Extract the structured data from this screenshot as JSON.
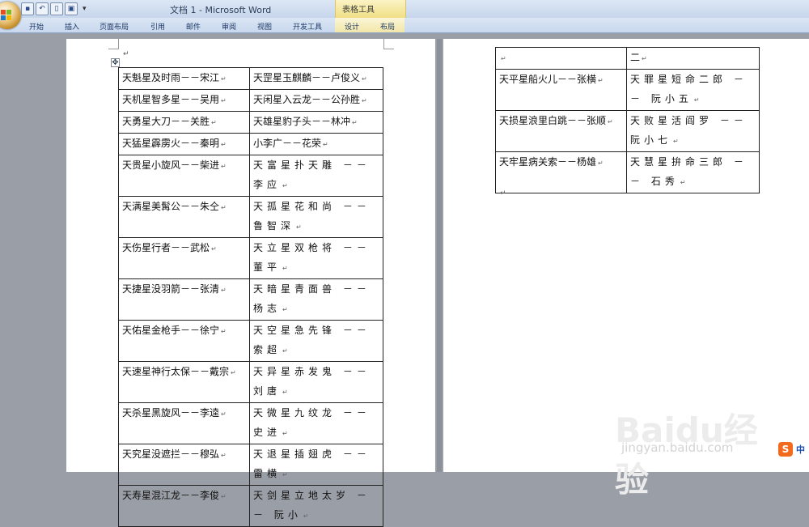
{
  "window": {
    "title": "文档 1 - Microsoft Word",
    "contextual_group": "表格工具",
    "qat_more": "▾"
  },
  "ribbon": {
    "tabs": [
      "开始",
      "插入",
      "页面布局",
      "引用",
      "邮件",
      "审阅",
      "视图",
      "开发工具",
      "设计",
      "布局"
    ]
  },
  "page1": {
    "rows": [
      [
        "天魁星及时雨－－宋江",
        "天罡星玉麒麟－－卢俊义"
      ],
      [
        "天机星智多星－－吴用",
        "天闲星入云龙－－公孙胜"
      ],
      [
        "天勇星大刀－－关胜",
        "天雄星豹子头－－林冲"
      ],
      [
        "天猛星霹雳火－－秦明",
        "小李广－－花荣"
      ],
      [
        "天贵星小旋风－－柴进",
        "天富星扑天雕 －－ 李应"
      ],
      [
        "天满星美髯公－－朱仝",
        "天孤星花和尚 －－ 鲁智深"
      ],
      [
        "天伤星行者－－武松",
        "天立星双枪将 －－ 董平"
      ],
      [
        "天捷星没羽箭－－张清",
        "天暗星青面兽 －－ 杨志"
      ],
      [
        "天佑星金枪手－－徐宁",
        "天空星急先锋 －－ 索超"
      ],
      [
        "天速星神行太保－－戴宗",
        "天异星赤发鬼 －－ 刘唐"
      ],
      [
        "天杀星黑旋风－－李逵",
        "天微星九纹龙 －－ 史进"
      ],
      [
        "天究星没遮拦－－穆弘",
        "天退星插翅虎 －－ 雷横"
      ],
      [
        "天寿星混江龙－－李俊",
        "天剑星立地太岁 －－ 阮小"
      ]
    ]
  },
  "page2": {
    "rows": [
      [
        "",
        "二"
      ],
      [
        "天平星船火儿－－张横",
        "天罪星短命二郎 －－ 阮小五"
      ],
      [
        "天损星浪里白跳－－张顺",
        "天败星活阎罗 －－ 阮小七"
      ],
      [
        "天牢星病关索－－杨雄",
        "天慧星拚命三郎 －－ 石秀"
      ]
    ]
  },
  "marks": {
    "return_mark": "↵",
    "move_handle": "✥"
  },
  "watermark": {
    "logo": "Baidu经验",
    "url": "jingyan.baidu.com"
  },
  "ime": {
    "logo": "S",
    "label": "中"
  },
  "colors": {
    "ribbon": "#c9d8ee",
    "contextual": "#f0df86",
    "ime": "#f26b1d"
  }
}
